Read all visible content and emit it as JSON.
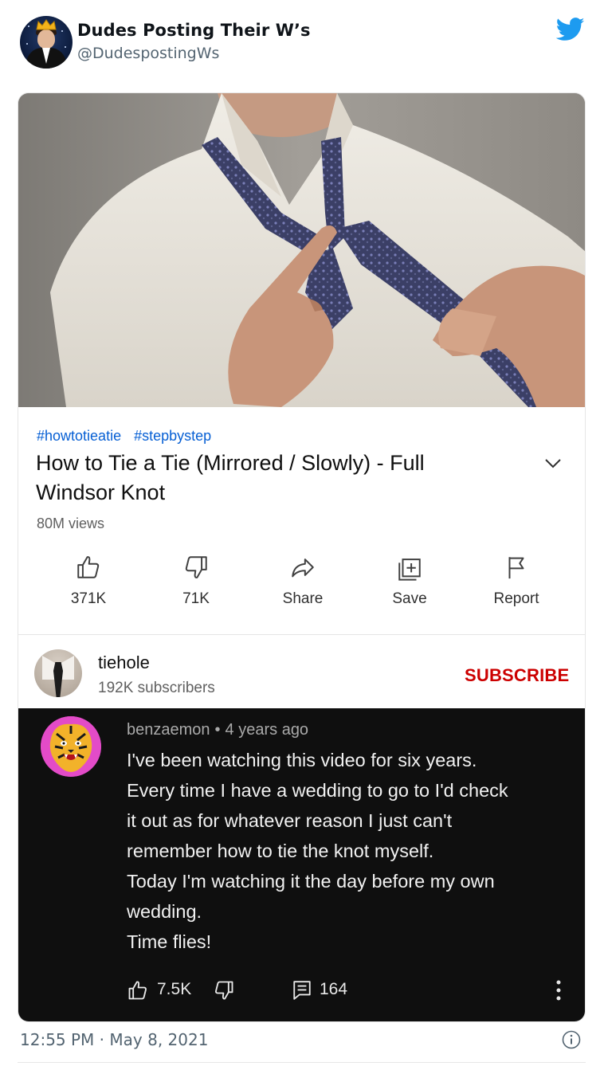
{
  "tweet": {
    "display_name": "Dudes Posting Their W’s",
    "handle": "@DudespostingWs",
    "timestamp": "12:55 PM · May 8, 2021",
    "brand_color": "#1d9bf0"
  },
  "video": {
    "tags": [
      "#howtotieatie",
      "#stepbystep"
    ],
    "title_lines": [
      "How to Tie a Tie (Mirrored / Slowly) - Full",
      "Windsor Knot"
    ],
    "views": "80M views",
    "actions": [
      {
        "icon": "thumbs-up-icon",
        "label": "371K"
      },
      {
        "icon": "thumbs-down-icon",
        "label": "71K"
      },
      {
        "icon": "share-icon",
        "label": "Share"
      },
      {
        "icon": "save-icon",
        "label": "Save"
      },
      {
        "icon": "flag-icon",
        "label": "Report"
      }
    ]
  },
  "channel": {
    "name": "tiehole",
    "subscribers": "192K subscribers",
    "subscribe_label": "SUBSCRIBE",
    "subscribe_color": "#cc0000"
  },
  "comment": {
    "author": "benzaemon",
    "separator": "•",
    "age": "4 years ago",
    "lines": [
      "I've been watching this video for six years.",
      "Every time I have a wedding to go to I'd check",
      "it out as for whatever reason I just can't",
      "remember how to tie the knot myself.",
      "Today I'm watching it the day before my own",
      "wedding.",
      "Time flies!"
    ],
    "likes": "7.5K",
    "replies": "164"
  }
}
